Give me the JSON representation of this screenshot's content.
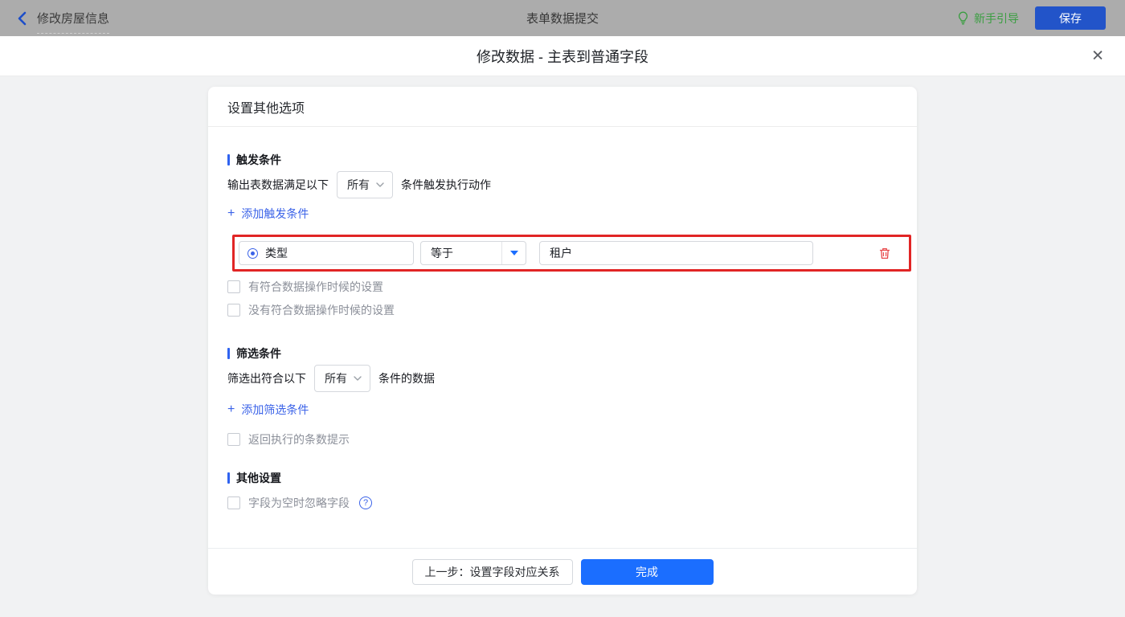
{
  "topbar": {
    "back_label": "修改房屋信息",
    "title": "表单数据提交",
    "guide_label": "新手引导",
    "save_label": "保存"
  },
  "modal": {
    "title": "修改数据 - 主表到普通字段",
    "close_glyph": "✕"
  },
  "panel": {
    "header": "设置其他选项",
    "trigger": {
      "title": "触发条件",
      "sentence_prefix": "输出表数据满足以下",
      "match_select_value": "所有",
      "sentence_suffix": "条件触发执行动作",
      "add_icon": "+",
      "add_label": "添加触发条件",
      "condition": {
        "field": "类型",
        "operator": "等于",
        "value": "租户"
      },
      "checkboxes": [
        "有符合数据操作时候的设置",
        "没有符合数据操作时候的设置"
      ]
    },
    "filter": {
      "title": "筛选条件",
      "sentence_prefix": "筛选出符合以下",
      "match_select_value": "所有",
      "sentence_suffix": "条件的数据",
      "add_icon": "+",
      "add_label": "添加筛选条件",
      "checkboxes": [
        "返回执行的条数提示"
      ]
    },
    "other": {
      "title": "其他设置",
      "checkboxes": [
        "字段为空时忽略字段"
      ],
      "help_glyph": "?"
    },
    "footer": {
      "prev_label": "上一步：设置字段对应关系",
      "done_label": "完成"
    }
  },
  "colors": {
    "accent_blue": "#3b63e8",
    "primary_button_blue": "#1b6eff",
    "topbar_save_blue": "#2254c9",
    "guide_green": "#3a9e41",
    "highlight_red": "#e12525",
    "trash_red": "#e8494b",
    "topbar_gray": "#acacac"
  }
}
